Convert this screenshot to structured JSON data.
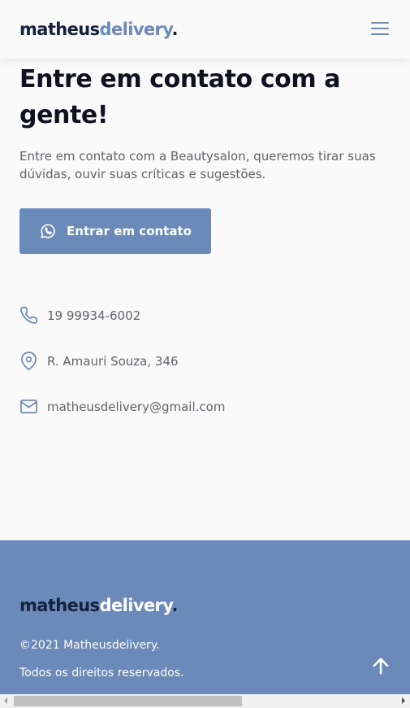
{
  "header": {
    "logo": {
      "part1": "matheus",
      "part2": "delivery",
      "part3": "."
    },
    "menu_icon": "hamburger-menu-icon"
  },
  "contact": {
    "title": "Entre em contato com a gente!",
    "description": "Entre em contato com a Beautysalon, queremos tirar suas dúvidas, ouvir suas críticas e sugestões.",
    "button_label": "Entrar em contato",
    "button_icon": "whatsapp-icon",
    "items": [
      {
        "icon": "phone-icon",
        "text": "19 99934-6002"
      },
      {
        "icon": "location-pin-icon",
        "text": "R. Amauri Souza, 346"
      },
      {
        "icon": "mail-icon",
        "text": "matheusdelivery@gmail.com"
      }
    ]
  },
  "footer": {
    "logo": {
      "part1": "matheus",
      "part2": "delivery",
      "part3": "."
    },
    "copyright": "©2021 Matheusdelivery.",
    "rights": "Todos os direitos reservados.",
    "back_to_top_icon": "arrow-up-icon"
  },
  "colors": {
    "accent": "#6b8ab9",
    "dark": "#14213d",
    "background": "#fafafa",
    "text_muted": "#5f6368"
  }
}
